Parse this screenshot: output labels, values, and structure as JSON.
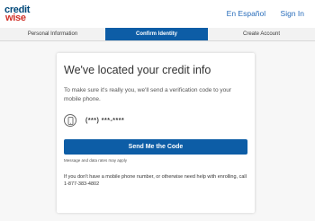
{
  "brand": {
    "line1": "credit",
    "line2": "wise"
  },
  "header": {
    "lang_link": "En Español",
    "signin_link": "Sign In"
  },
  "steps": [
    "Personal Information",
    "Confirm Identity",
    "Create Account"
  ],
  "card": {
    "title": "We've located your credit info",
    "description": "To make sure it's really you, we'll send a verification code to your mobile phone.",
    "phone_masked": "(***) ***-****",
    "button_label": "Send Me the Code",
    "rates_note": "Message and data rates may apply",
    "help_text": "If you don't have a mobile phone number, or otherwise need help with enrolling, call 1-877-383-4802"
  },
  "colors": {
    "primary": "#0d5da6",
    "brand_blue": "#004879",
    "brand_red": "#d03027",
    "link": "#2a6ebb"
  },
  "icons": {
    "phone": "mobile-phone-icon"
  }
}
